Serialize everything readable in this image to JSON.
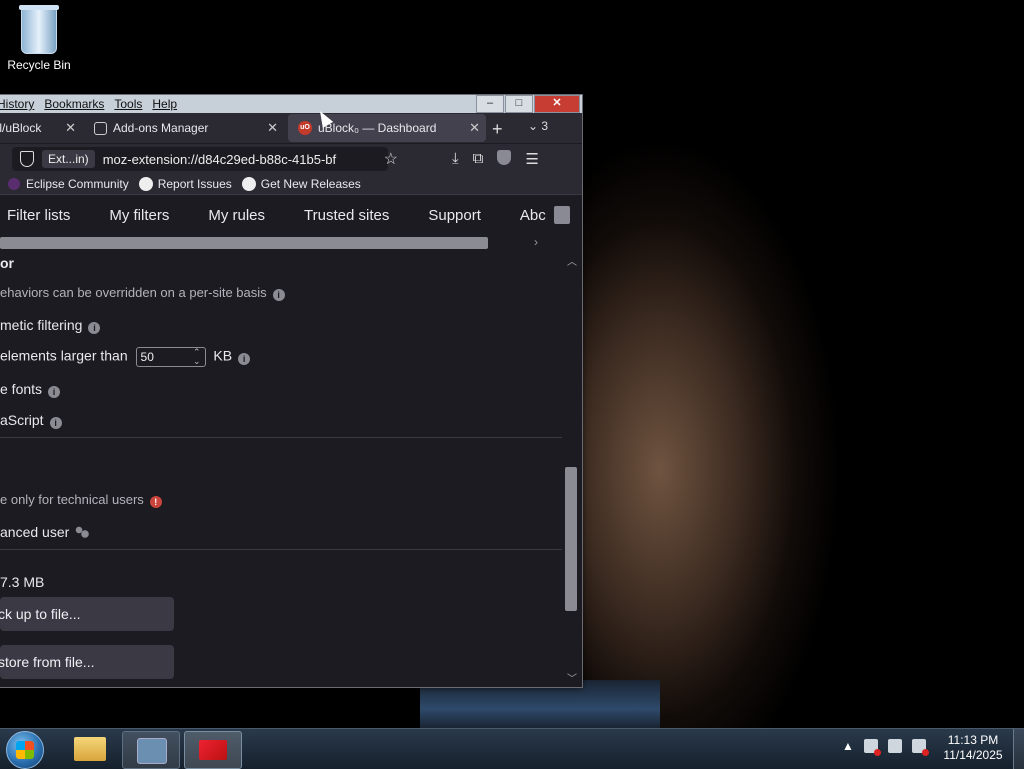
{
  "desktop": {
    "recycle_bin_label": "Recycle Bin"
  },
  "menubar": {
    "items": [
      "History",
      "Bookmarks",
      "Tools",
      "Help"
    ]
  },
  "tabs": [
    {
      "label": "ill/uBlock",
      "active": false
    },
    {
      "label": "Add-ons Manager",
      "active": false
    },
    {
      "label": "uBlock₀ — Dashboard",
      "active": true
    }
  ],
  "tab_count": "3",
  "navbar": {
    "ext_pill": "Ext...in)",
    "url": "moz-extension://d84c29ed-b88c-41b5-bf"
  },
  "bookmarks": [
    "Eclipse Community",
    "Report Issues",
    "Get New Releases"
  ],
  "dashboard_tabs": [
    "Filter lists",
    "My filters",
    "My rules",
    "Trusted sites",
    "Support",
    "Abc"
  ],
  "settings": {
    "section_title": "or",
    "behaviors_note": "ehaviors can be overridden on a per-site basis",
    "cosmetic": "metic filtering",
    "large_media_prefix": "elements larger than",
    "large_media_value": "50",
    "large_media_unit": "KB",
    "fonts": "e fonts",
    "javascript": "aScript",
    "advanced_note": "e only for technical users",
    "advanced_user": "anced user",
    "storage": "7.3 MB",
    "backup_button": "ck up to file...",
    "restore_button": "store from file..."
  },
  "taskbar": {
    "time": "11:13 PM",
    "date": "11/14/2025"
  }
}
